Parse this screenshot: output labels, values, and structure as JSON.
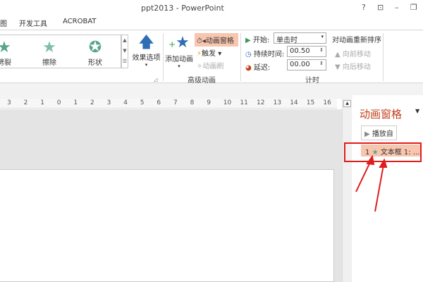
{
  "window": {
    "title": "ppt2013 - PowerPoint",
    "help": "?",
    "restore_ribbon": "⊡",
    "minimize": "–",
    "restore": "❐"
  },
  "tabs": [
    "图",
    "开发工具",
    "ACROBAT"
  ],
  "gallery": [
    {
      "label": "劈裂"
    },
    {
      "label": "擦除"
    },
    {
      "label": "形状"
    }
  ],
  "effect_options": "效果选项",
  "advanced": {
    "add_animation": "添加动画",
    "animation_pane": "动画窗格",
    "trigger": "触发",
    "painter": "动画刷",
    "group_label": "高级动画"
  },
  "timing": {
    "start_label": "开始:",
    "start_value": "单击时",
    "duration_label": "持续时间:",
    "duration_value": "00.50",
    "delay_label": "延迟:",
    "delay_value": "00.00",
    "reorder": "对动画重新排序",
    "move_earlier": "向前移动",
    "move_later": "向后移动",
    "group_label": "计时"
  },
  "ruler": [
    "3",
    "2",
    "1",
    "0",
    "1",
    "2",
    "3",
    "4",
    "5",
    "6",
    "7",
    "8",
    "9",
    "10",
    "11",
    "12",
    "13",
    "14",
    "15",
    "16"
  ],
  "pane": {
    "title": "动画窗格",
    "play_from": "播放自",
    "item_number": "1",
    "item_label": "文本框 1: ..."
  },
  "colors": {
    "accent": "#c43e1c",
    "highlight": "#f8c5ae",
    "annotation": "#e21b1b"
  }
}
